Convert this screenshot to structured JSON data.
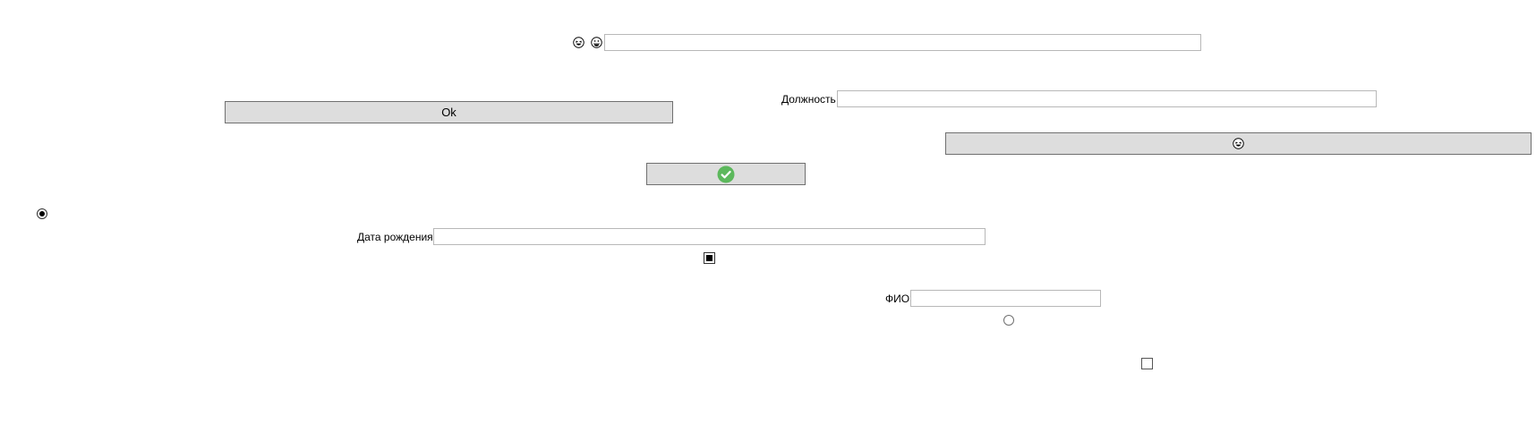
{
  "top_row": {
    "icons": [
      "grinning-squint-face-icon",
      "grinning-face-icon"
    ],
    "input_value": ""
  },
  "position_field": {
    "label": "Должность",
    "value": ""
  },
  "ok_button": {
    "label": "Ok"
  },
  "emoji_button": {
    "icon": "grinning-squint-face-icon"
  },
  "check_button": {
    "icon": "green-check-circle-icon",
    "accent": "#5cb85c"
  },
  "radio_1": {
    "checked": true
  },
  "birthdate_field": {
    "label": "Дата рождения",
    "value": ""
  },
  "checkbox_1": {
    "state": "indeterminate"
  },
  "fullname_field": {
    "label": "ФИО",
    "value": ""
  },
  "radio_2": {
    "checked": false
  },
  "checkbox_2": {
    "checked": false
  },
  "colors": {
    "button_bg": "#dddddd",
    "button_border": "#707070",
    "input_border": "#b8b8b8",
    "check_green": "#5cb85c"
  }
}
